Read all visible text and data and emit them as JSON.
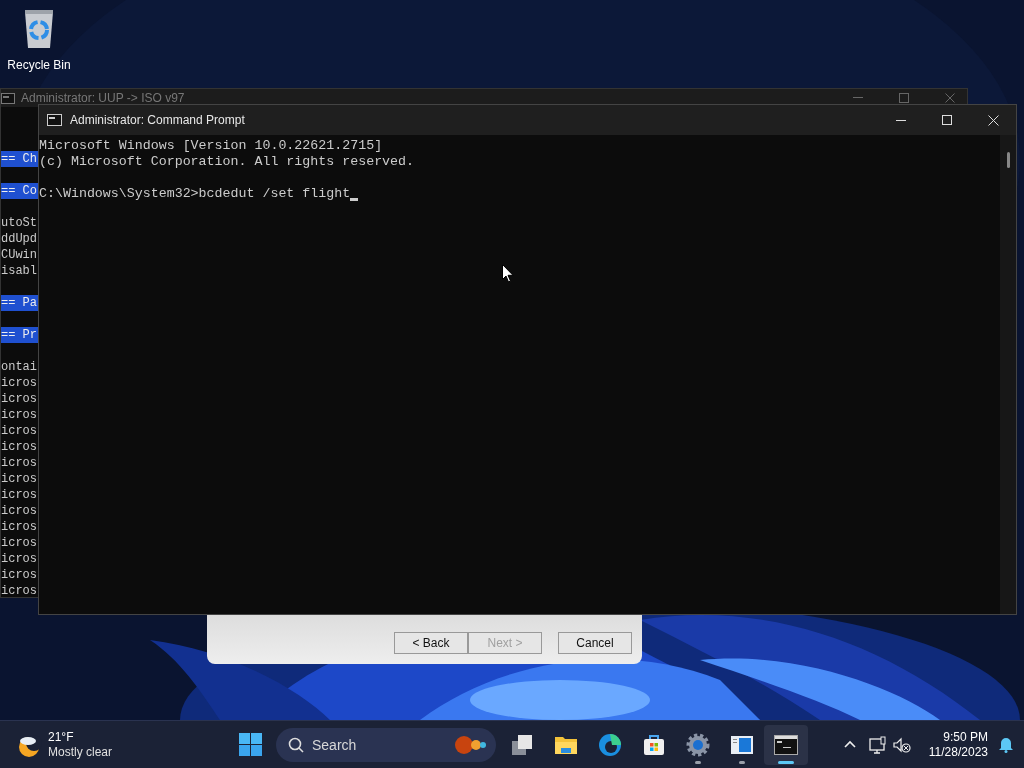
{
  "desktop_icons": [
    {
      "label": "Recycle Bin"
    }
  ],
  "background_window": {
    "title": "Administrator: UUP -> ISO v97",
    "blocks": [
      [
        {
          "text": "== Ch",
          "highlighted": true
        }
      ],
      [
        {
          "text": "== Co",
          "highlighted": true
        }
      ],
      [
        {
          "text": "utoSt",
          "highlighted": false
        },
        {
          "text": "ddUpd",
          "highlighted": false
        },
        {
          "text": "CUwin",
          "highlighted": false
        },
        {
          "text": "isabl",
          "highlighted": false
        }
      ],
      [
        {
          "text": "== Pa",
          "highlighted": true
        }
      ],
      [
        {
          "text": "== Pr",
          "highlighted": true
        }
      ],
      [
        {
          "text": "ontai",
          "highlighted": false
        },
        {
          "text": "icros",
          "highlighted": false
        },
        {
          "text": "icros",
          "highlighted": false
        },
        {
          "text": "icros",
          "highlighted": false
        },
        {
          "text": "icros",
          "highlighted": false
        },
        {
          "text": "icros",
          "highlighted": false
        },
        {
          "text": "icros",
          "highlighted": false
        },
        {
          "text": "icros",
          "highlighted": false
        },
        {
          "text": "icros",
          "highlighted": false
        },
        {
          "text": "icros",
          "highlighted": false
        },
        {
          "text": "icros",
          "highlighted": false
        },
        {
          "text": "icros",
          "highlighted": false
        },
        {
          "text": "icros",
          "highlighted": false
        },
        {
          "text": "icros",
          "highlighted": false
        },
        {
          "text": "icros",
          "highlighted": false
        }
      ]
    ]
  },
  "wizard": {
    "buttons": [
      {
        "label": "< Back",
        "disabled": false
      },
      {
        "label": "Next >",
        "disabled": true
      },
      {
        "label": "Cancel",
        "disabled": false
      }
    ]
  },
  "command_prompt": {
    "title": "Administrator: Command Prompt",
    "blocks": [
      [
        "Microsoft Windows [Version 10.0.22621.2715]",
        "(c) Microsoft Corporation. All rights reserved."
      ],
      [
        "C:\\Windows\\System32>bcdedut /set flight"
      ]
    ]
  },
  "taskbar": {
    "weather": {
      "temperature": "21°F",
      "condition": "Mostly clear"
    },
    "search": {
      "placeholder": "Search"
    },
    "apps": [
      {
        "kind": "task-view",
        "running": false,
        "selected": false
      },
      {
        "kind": "file-explorer",
        "running": false,
        "selected": false
      },
      {
        "kind": "edge",
        "running": false,
        "selected": false
      },
      {
        "kind": "store",
        "running": false,
        "selected": false
      },
      {
        "kind": "settings",
        "running": true,
        "selected": false
      },
      {
        "kind": "window",
        "running": true,
        "selected": false
      },
      {
        "kind": "terminal",
        "running": true,
        "selected": true
      }
    ],
    "clock": {
      "time": "9:50 PM",
      "date": "11/28/2023"
    }
  }
}
